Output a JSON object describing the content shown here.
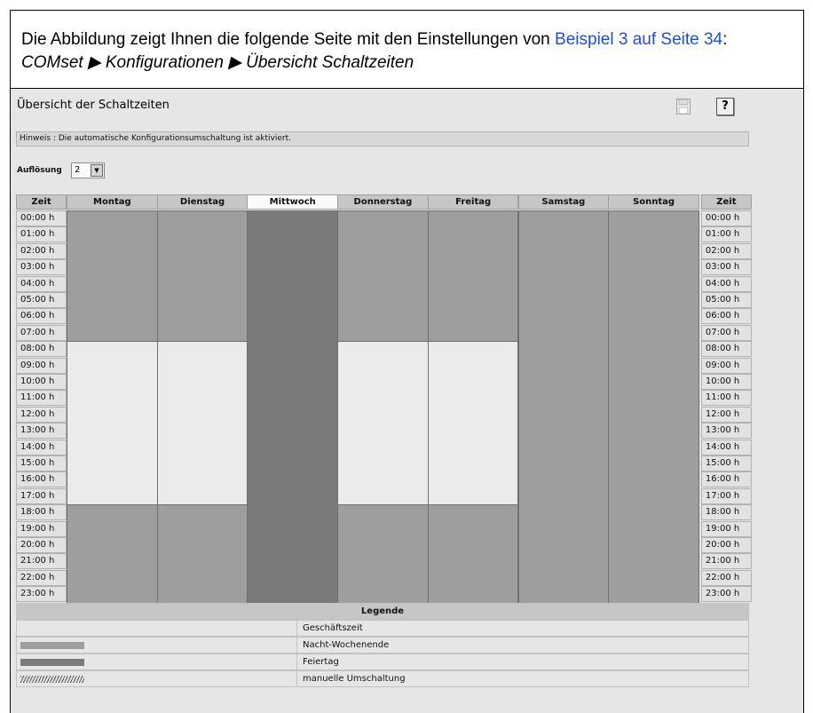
{
  "intro": {
    "text_before": "Die Abbildung zeigt Ihnen die folgende Seite mit den Einstellungen von ",
    "link": "Beispiel 3 auf Seite 34",
    "text_after": ":",
    "path": "COMset ▶ Konfigurationen ▶ Übersicht Schaltzeiten"
  },
  "page": {
    "title": "Übersicht der Schaltzeiten",
    "hint": "Hinweis : Die automatische Konfigurationsumschaltung ist aktiviert.",
    "resolution_label": "Auflösung",
    "resolution_value": "2",
    "save_icon": "save-icon",
    "help_icon": "?"
  },
  "schedule": {
    "time_header": "Zeit",
    "days": [
      "Montag",
      "Dienstag",
      "Mittwoch",
      "Donnerstag",
      "Freitag",
      "Samstag",
      "Sonntag"
    ],
    "current_day": "Mittwoch",
    "hours": [
      "00:00 h",
      "01:00 h",
      "02:00 h",
      "03:00 h",
      "04:00 h",
      "05:00 h",
      "06:00 h",
      "07:00 h",
      "08:00 h",
      "09:00 h",
      "10:00 h",
      "11:00 h",
      "12:00 h",
      "13:00 h",
      "14:00 h",
      "15:00 h",
      "16:00 h",
      "17:00 h",
      "18:00 h",
      "19:00 h",
      "20:00 h",
      "21:00 h",
      "22:00 h",
      "23:00 h"
    ],
    "colors": {
      "geschaeftszeit": "#ebebeb",
      "nacht_wochenende": "#9e9e9e",
      "feiertag": "#7a7a7a"
    },
    "blocks": [
      {
        "day": 0,
        "start": 0,
        "end": 8,
        "type": "nacht_wochenende"
      },
      {
        "day": 0,
        "start": 8,
        "end": 18,
        "type": "geschaeftszeit"
      },
      {
        "day": 0,
        "start": 18,
        "end": 24,
        "type": "nacht_wochenende"
      },
      {
        "day": 1,
        "start": 0,
        "end": 8,
        "type": "nacht_wochenende"
      },
      {
        "day": 1,
        "start": 8,
        "end": 18,
        "type": "geschaeftszeit"
      },
      {
        "day": 1,
        "start": 18,
        "end": 24,
        "type": "nacht_wochenende"
      },
      {
        "day": 2,
        "start": 0,
        "end": 24,
        "type": "feiertag"
      },
      {
        "day": 3,
        "start": 0,
        "end": 8,
        "type": "nacht_wochenende"
      },
      {
        "day": 3,
        "start": 8,
        "end": 18,
        "type": "geschaeftszeit"
      },
      {
        "day": 3,
        "start": 18,
        "end": 24,
        "type": "nacht_wochenende"
      },
      {
        "day": 4,
        "start": 0,
        "end": 8,
        "type": "nacht_wochenende"
      },
      {
        "day": 4,
        "start": 8,
        "end": 18,
        "type": "geschaeftszeit"
      },
      {
        "day": 4,
        "start": 18,
        "end": 24,
        "type": "nacht_wochenende"
      },
      {
        "day": 5,
        "start": 0,
        "end": 24,
        "type": "nacht_wochenende"
      },
      {
        "day": 6,
        "start": 0,
        "end": 24,
        "type": "nacht_wochenende"
      }
    ]
  },
  "legend": {
    "title": "Legende",
    "items": [
      {
        "label": "Geschäftszeit",
        "type": "geschaeftszeit"
      },
      {
        "label": "Nacht-Wochenende",
        "type": "nacht_wochenende"
      },
      {
        "label": "Feiertag",
        "type": "feiertag"
      },
      {
        "label": "manuelle Umschaltung",
        "type": "manuell"
      }
    ]
  }
}
